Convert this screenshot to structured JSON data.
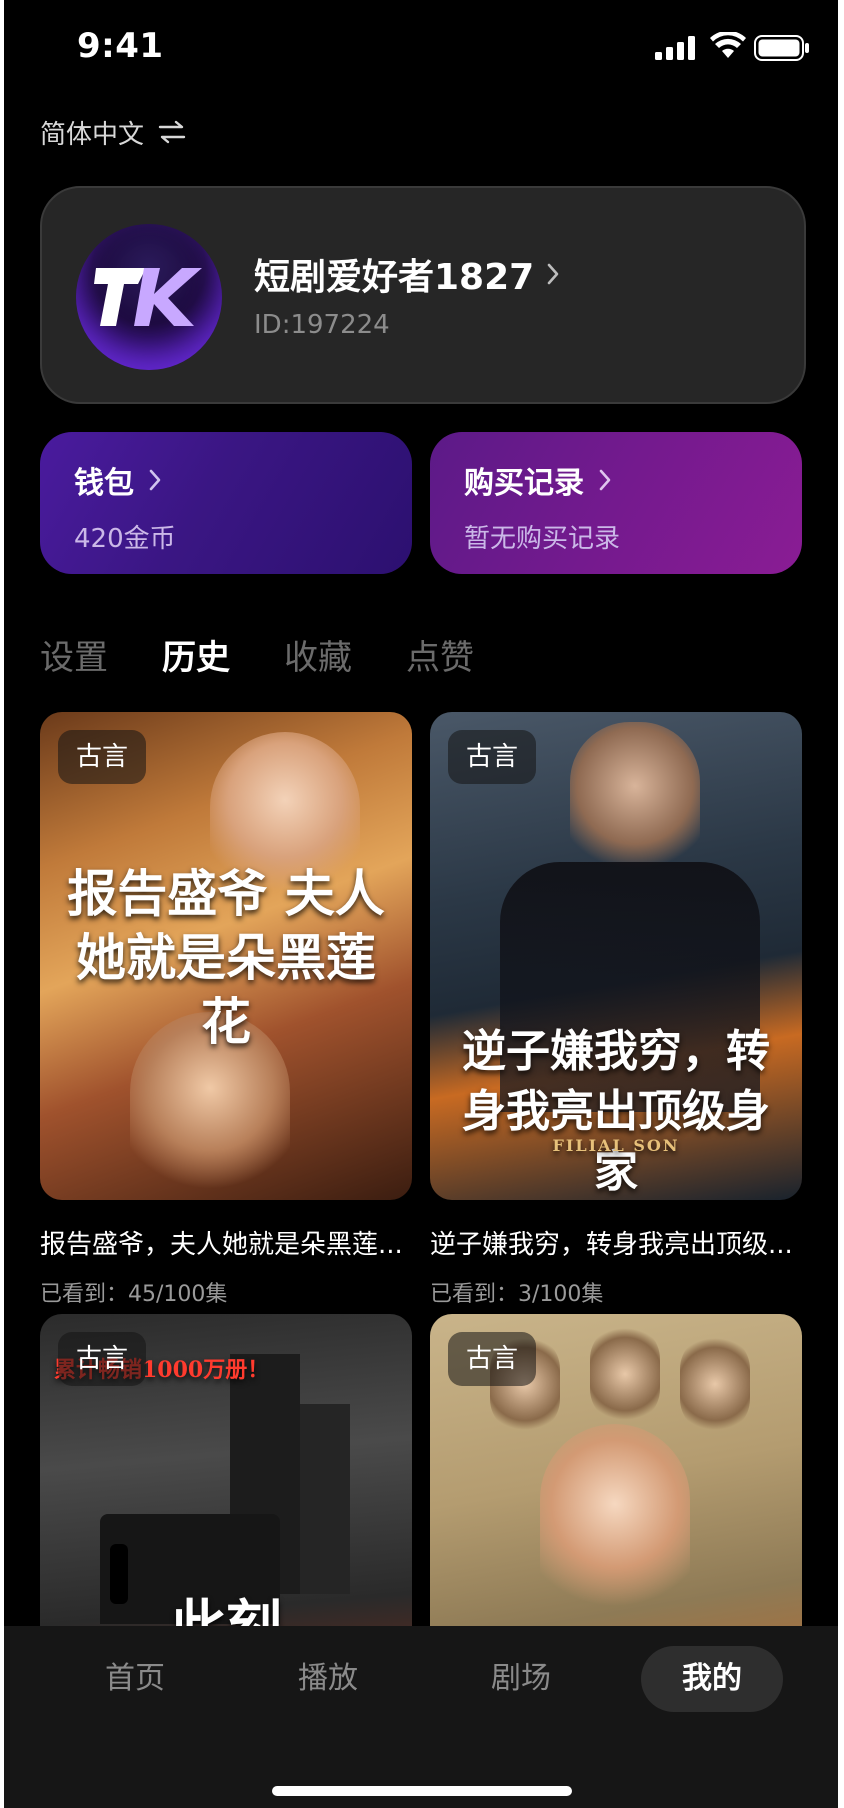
{
  "status_bar": {
    "time": "9:41"
  },
  "language": {
    "label": "简体中文"
  },
  "profile": {
    "username": "短剧爱好者1827",
    "id": "ID:197224"
  },
  "wallet": {
    "title": "钱包",
    "subtitle": "420金币"
  },
  "purchase": {
    "title": "购买记录",
    "subtitle": "暂无购买记录"
  },
  "tabs": [
    {
      "label": "设置",
      "active": false
    },
    {
      "label": "历史",
      "active": true
    },
    {
      "label": "收藏",
      "active": false
    },
    {
      "label": "点赞",
      "active": false
    }
  ],
  "cards": [
    {
      "genre": "古言",
      "title": "报告盛爷，夫人她就是朵黑莲...",
      "progress": "已看到：45/100集",
      "poster_text": "报告盛爷 夫人她就是朵黑莲花"
    },
    {
      "genre": "古言",
      "title": "逆子嫌我穷，转身我亮出顶级...",
      "progress": "已看到：3/100集",
      "poster_text": "逆子嫌我穷，转身我亮出顶级身家",
      "poster_subtext": "FILIAL SON"
    },
    {
      "genre": "古言",
      "poster_text": "累计畅销1000万册！",
      "poster_subtext": "此刻"
    },
    {
      "genre": "古言"
    }
  ],
  "bottom_nav": [
    {
      "label": "首页",
      "active": false
    },
    {
      "label": "播放",
      "active": false
    },
    {
      "label": "剧场",
      "active": false
    },
    {
      "label": "我的",
      "active": true
    }
  ],
  "colors": {
    "background": "#000000",
    "wallet_gradient": "#3a1683",
    "purchase_gradient": "#741a8e",
    "tab_inactive": "#6b6b6b"
  }
}
